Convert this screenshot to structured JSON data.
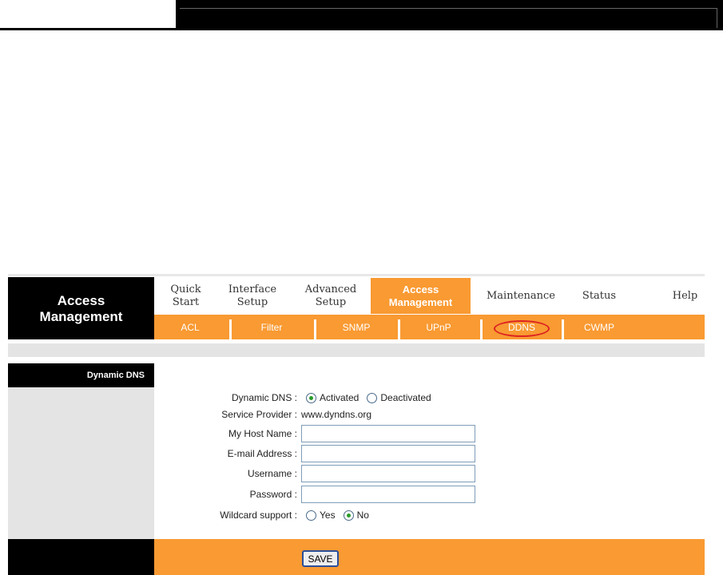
{
  "brand": {
    "line1": "Access",
    "line2": "Management"
  },
  "tabs": [
    {
      "l1": "Quick",
      "l2": "Start"
    },
    {
      "l1": "Interface",
      "l2": "Setup"
    },
    {
      "l1": "Advanced",
      "l2": "Setup"
    },
    {
      "l1": "Access",
      "l2": "Management"
    },
    {
      "l1": "Maintenance",
      "l2": ""
    },
    {
      "l1": "Status",
      "l2": ""
    },
    {
      "l1": "Help",
      "l2": ""
    }
  ],
  "subtabs": [
    "ACL",
    "Filter",
    "SNMP",
    "UPnP",
    "DDNS",
    "CWMP"
  ],
  "section_title": "Dynamic DNS",
  "form": {
    "ddns_label": "Dynamic DNS :",
    "activated": "Activated",
    "deactivated": "Deactivated",
    "provider_label": "Service Provider :",
    "provider_value": "www.dyndns.org",
    "host_label": "My Host Name :",
    "host_value": "",
    "email_label": "E-mail Address :",
    "email_value": "",
    "user_label": "Username :",
    "user_value": "",
    "pass_label": "Password :",
    "pass_value": "",
    "wildcard_label": "Wildcard support :",
    "yes": "Yes",
    "no": "No"
  },
  "save_label": "SAVE"
}
